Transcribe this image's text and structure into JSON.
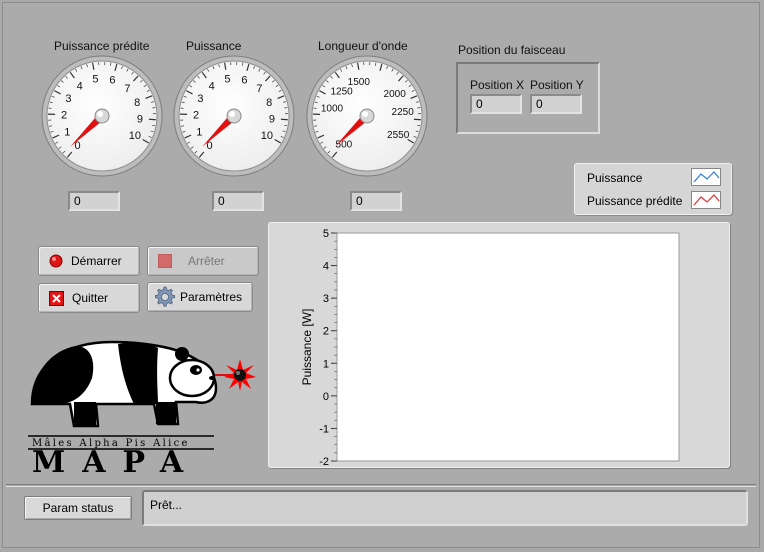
{
  "gauges": [
    {
      "title": "Puissance prédite",
      "ticks": [
        "0",
        "1",
        "2",
        "3",
        "4",
        "5",
        "6",
        "7",
        "8",
        "9",
        "10"
      ],
      "value": 0,
      "readout": "0"
    },
    {
      "title": "Puissance",
      "ticks": [
        "0",
        "1",
        "2",
        "3",
        "4",
        "5",
        "6",
        "7",
        "8",
        "9",
        "10"
      ],
      "value": 0,
      "readout": "0"
    },
    {
      "title": "Longueur d'onde",
      "ticks": [
        "500",
        "1000",
        "1250",
        "1500",
        "2000",
        "2250",
        "2550"
      ],
      "value": 550,
      "readout": "0"
    }
  ],
  "beam": {
    "title": "Position du faisceau",
    "x_label": "Position X",
    "x_value": "0",
    "y_label": "Position Y",
    "y_value": "0"
  },
  "legend": {
    "items": [
      {
        "label": "Puissance",
        "color": "#2a7fd4"
      },
      {
        "label": "Puissance prédite",
        "color": "#e03030"
      }
    ]
  },
  "buttons": {
    "start": "Démarrer",
    "stop": "Arrêter",
    "quit": "Quitter",
    "settings": "Paramètres"
  },
  "logo": {
    "tagline": "Mâles Alpha Pis Alice",
    "name": "MAPA"
  },
  "chart_data": {
    "type": "line",
    "ylabel": "Puissance [W]",
    "ylim": [
      -2,
      5
    ],
    "yticks": [
      "5",
      "4",
      "3",
      "2",
      "1",
      "0",
      "-1",
      "-2"
    ],
    "series": [
      {
        "name": "Puissance",
        "values": []
      },
      {
        "name": "Puissance prédite",
        "values": []
      }
    ]
  },
  "status": {
    "button": "Param status",
    "text": "Prêt..."
  }
}
